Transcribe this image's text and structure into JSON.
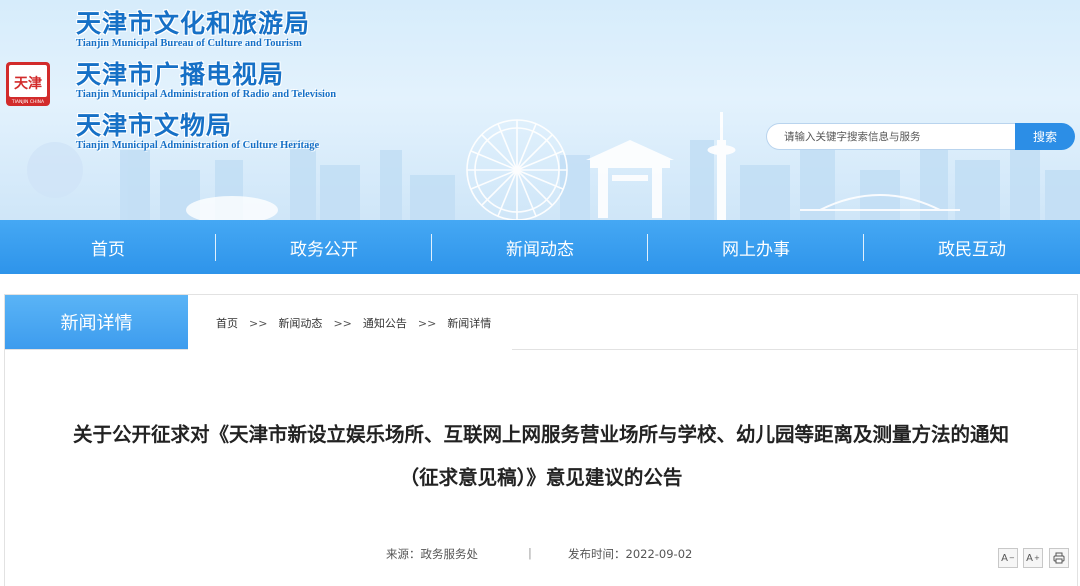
{
  "header": {
    "orgs": [
      {
        "cn": "天津市文化和旅游局",
        "en": "Tianjin Municipal Bureau of Culture and Tourism"
      },
      {
        "cn": "天津市广播电视局",
        "en": "Tianjin Municipal Administration of Radio and Television"
      },
      {
        "cn": "天津市文物局",
        "en": "Tianjin Municipal Administration of Culture Heritage"
      }
    ],
    "seal": {
      "line1": "天津",
      "caption": "TIANJIN CHINA"
    },
    "search": {
      "placeholder": "请输入关键字搜索信息与服务",
      "button_label": "搜索"
    }
  },
  "nav": {
    "items": [
      {
        "label": "首页"
      },
      {
        "label": "政务公开"
      },
      {
        "label": "新闻动态"
      },
      {
        "label": "网上办事"
      },
      {
        "label": "政民互动"
      }
    ]
  },
  "section": {
    "tab_label": "新闻详情",
    "breadcrumb": [
      "首页",
      "新闻动态",
      "通知公告",
      "新闻详情"
    ],
    "separator": ">>"
  },
  "article": {
    "title_line1": "关于公开征求对《天津市新设立娱乐场所、互联网上网服务营业场所与学校、幼儿园等距离及测量方法的通知",
    "title_line2": "（征求意见稿）》意见建议的公告",
    "source": "来源：政务服务处",
    "divider": "|",
    "date": "发布时间：2022-09-02"
  },
  "tools": {
    "decrease": "A",
    "increase": "A",
    "print": "print-icon"
  },
  "colors": {
    "brand_blue": "#2e94ea",
    "title_blue": "#1670c6",
    "seal_red": "#d22b2b"
  }
}
